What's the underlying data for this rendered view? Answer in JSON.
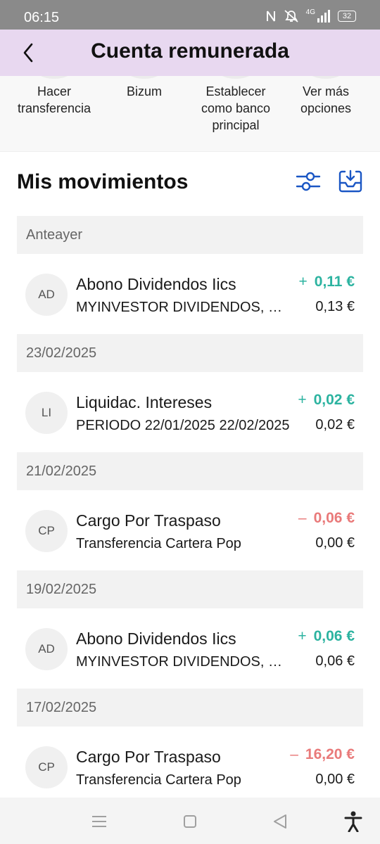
{
  "status_bar": {
    "time": "06:15",
    "network": "4G",
    "battery": "32",
    "icons": [
      "nfc-icon",
      "mute-icon",
      "signal-icon",
      "battery-icon"
    ]
  },
  "header": {
    "title": "Cuenta remunerada",
    "back_icon": "chevron-left-icon",
    "background": "#e8d8f0"
  },
  "actions": [
    {
      "label": "Hacer\ntransferencia"
    },
    {
      "label": "Bizum"
    },
    {
      "label": "Establecer\ncomo banco\nprincipal"
    },
    {
      "label": "Ver más\nopciones"
    }
  ],
  "movements": {
    "title": "Mis movimientos",
    "filter_icon": "sliders-icon",
    "download_icon": "download-tray-icon",
    "accent": "#1a56c4",
    "groups": [
      {
        "date": "Anteayer",
        "items": [
          {
            "initials": "AD",
            "title": "Abono Dividendos Iics",
            "subtitle": "MYINVESTOR DIVIDENDOS, S.A.",
            "sign": "+",
            "amount": "0,11 €",
            "balance": "0,13 €",
            "type": "credit"
          }
        ]
      },
      {
        "date": "23/02/2025",
        "items": [
          {
            "initials": "LI",
            "title": "Liquidac. Intereses",
            "subtitle": "PERIODO 22/01/2025 22/02/2025",
            "sign": "+",
            "amount": "0,02 €",
            "balance": "0,02 €",
            "type": "credit"
          }
        ]
      },
      {
        "date": "21/02/2025",
        "items": [
          {
            "initials": "CP",
            "title": "Cargo Por Traspaso",
            "subtitle": "Transferencia Cartera Pop",
            "sign": "–",
            "amount": "0,06 €",
            "balance": "0,00 €",
            "type": "debit"
          }
        ]
      },
      {
        "date": "19/02/2025",
        "items": [
          {
            "initials": "AD",
            "title": "Abono Dividendos Iics",
            "subtitle": "MYINVESTOR DIVIDENDOS, S.A.",
            "sign": "+",
            "amount": "0,06 €",
            "balance": "0,06 €",
            "type": "credit"
          }
        ]
      },
      {
        "date": "17/02/2025",
        "items": [
          {
            "initials": "CP",
            "title": "Cargo Por Traspaso",
            "subtitle": "Transferencia Cartera Pop",
            "sign": "–",
            "amount": "16,20 €",
            "balance": "0,00 €",
            "type": "debit"
          }
        ]
      }
    ],
    "colors": {
      "credit": "#2cb3a0",
      "debit": "#e97a7a"
    }
  },
  "nav_bar": {
    "buttons": [
      "menu-icon",
      "home-square-icon",
      "back-triangle-icon",
      "accessibility-icon"
    ]
  }
}
